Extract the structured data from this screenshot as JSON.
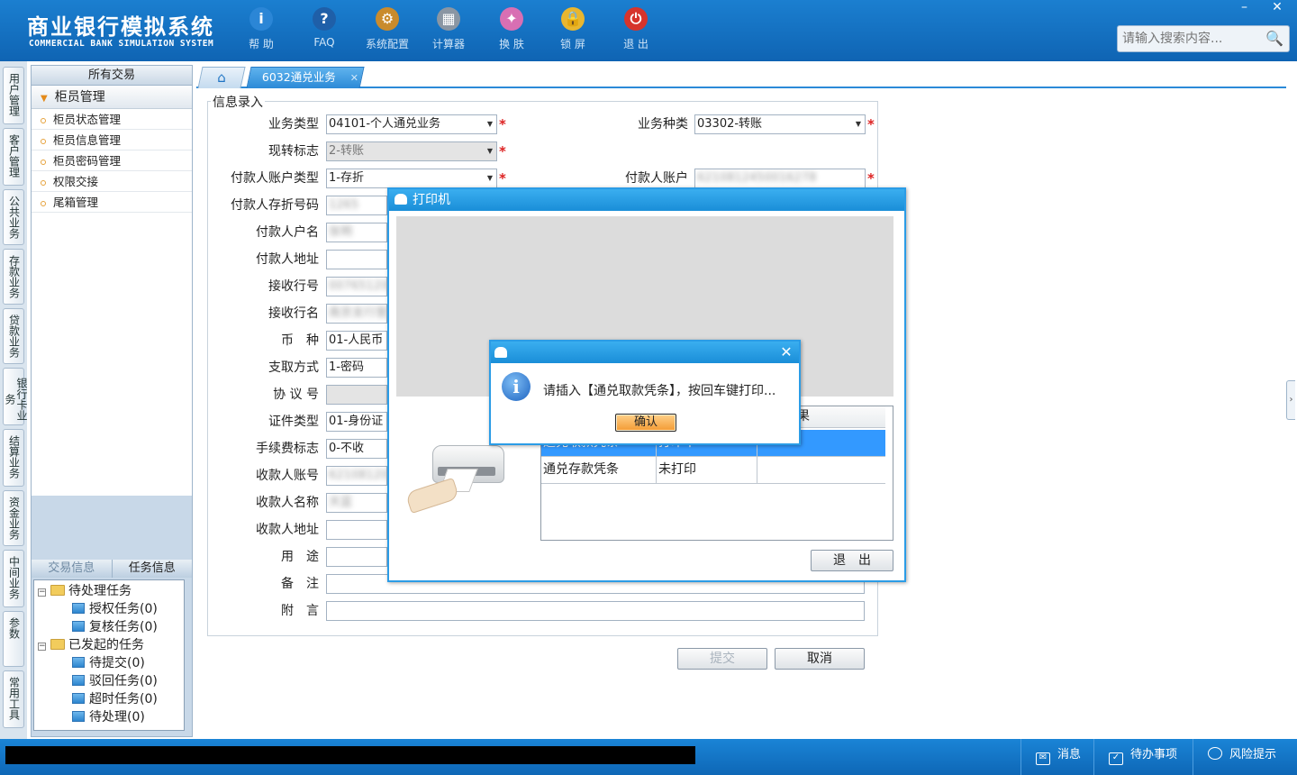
{
  "app": {
    "title": "商业银行模拟系统",
    "subtitle": "COMMERCIAL BANK SIMULATION SYSTEM",
    "toolbar": [
      {
        "label": "帮 助",
        "icon": "help-icon",
        "glyph": "i",
        "color": "#2b86d6"
      },
      {
        "label": "FAQ",
        "icon": "faq-icon",
        "glyph": "?",
        "color": "#1f5fa8"
      },
      {
        "label": "系统配置",
        "icon": "config-icon",
        "glyph": "⚙",
        "color": "#c98b2c"
      },
      {
        "label": "计算器",
        "icon": "calculator-icon",
        "glyph": "▦",
        "color": "#8a96a3"
      },
      {
        "label": "换 肤",
        "icon": "skin-icon",
        "glyph": "✦",
        "color": "#d86fb3"
      },
      {
        "label": "锁 屏",
        "icon": "lock-icon",
        "glyph": "🔒",
        "color": "#e8b62f"
      },
      {
        "label": "退 出",
        "icon": "power-icon",
        "glyph": "⏻",
        "color": "#d6342c"
      }
    ],
    "window_buttons": {
      "minimize": "–",
      "close": "✕"
    },
    "search_placeholder": "请输入搜索内容..."
  },
  "modules": [
    "用户管理",
    "客户管理",
    "公共业务",
    "存款业务",
    "贷款业务",
    "银行卡业务",
    "结算业务",
    "资金业务",
    "中间业务",
    "参数",
    "常用工具"
  ],
  "nav": {
    "header": "所有交易",
    "group": "柜员管理",
    "items": [
      "柜员状态管理",
      "柜员信息管理",
      "柜员密码管理",
      "权限交接",
      "尾箱管理"
    ]
  },
  "tasks": {
    "tabs": [
      "交易信息",
      "任务信息"
    ],
    "pending": {
      "label": "待处理任务",
      "children": [
        "授权任务(0)",
        "复核任务(0)"
      ]
    },
    "initiated": {
      "label": "已发起的任务",
      "children": [
        "待提交(0)",
        "驳回任务(0)",
        "超时任务(0)",
        "待处理(0)"
      ]
    }
  },
  "main": {
    "home_tab_icon": "home-icon",
    "active_tab": "6032通兑业务",
    "section": "信息录入",
    "fields": {
      "business_type": {
        "label": "业务类型",
        "value": "04101-个人通兑业务"
      },
      "business_kind": {
        "label": "业务种类",
        "value": "03302-转账"
      },
      "cash_flag": {
        "label": "现转标志",
        "value": "2-转账"
      },
      "payer_account_type": {
        "label": "付款人账户类型",
        "value": "1-存折"
      },
      "payer_account": {
        "label": "付款人账户",
        "value": "6210812450016278"
      },
      "payer_passbook_no": {
        "label": "付款人存折号码",
        "value": "1265"
      },
      "payer_name": {
        "label": "付款人户名",
        "value": "张明"
      },
      "payer_address": {
        "label": "付款人地址",
        "value": ""
      },
      "receiving_bank_no": {
        "label": "接收行号",
        "value": "007651200"
      },
      "receiving_bank_name": {
        "label": "接收行名",
        "value": "南京支行营业"
      },
      "currency": {
        "label": "币　种",
        "value": "01-人民币"
      },
      "withdraw_method": {
        "label": "支取方式",
        "value": "1-密码"
      },
      "agreement_no": {
        "label": "协 议 号",
        "value": ""
      },
      "id_type": {
        "label": "证件类型",
        "value": "01-身份证"
      },
      "fee_flag": {
        "label": "手续费标志",
        "value": "0-不收"
      },
      "payee_account": {
        "label": "收款人账号",
        "value": "6210812016"
      },
      "payee_name": {
        "label": "收款人名称",
        "value": "天蓝"
      },
      "payee_address": {
        "label": "收款人地址",
        "value": ""
      },
      "purpose": {
        "label": "用　途",
        "value": ""
      },
      "remark": {
        "label": "备　注",
        "value": ""
      },
      "postscript": {
        "label": "附　言",
        "value": ""
      }
    },
    "submit": "提交",
    "cancel": "取消"
  },
  "printer_dialog": {
    "title": "打印机",
    "table_header_partial": "果",
    "rows": [
      {
        "name": "通兑取款凭条",
        "status": "打印中",
        "result": ""
      },
      {
        "name": "通兑存款凭条",
        "status": "未打印",
        "result": ""
      }
    ],
    "exit": "退　出"
  },
  "alert": {
    "message": "请插入【通兑取款凭条】，按回车键打印...",
    "ok": "确认",
    "close": "✕"
  },
  "statusbar": {
    "messages": "消息",
    "todo": "待办事项",
    "risk": "风险提示"
  },
  "colors": {
    "header_blue": "#1673c4",
    "accent_blue": "#2b9ce6",
    "required_red": "#d22222",
    "selection_blue": "#3399ff"
  }
}
